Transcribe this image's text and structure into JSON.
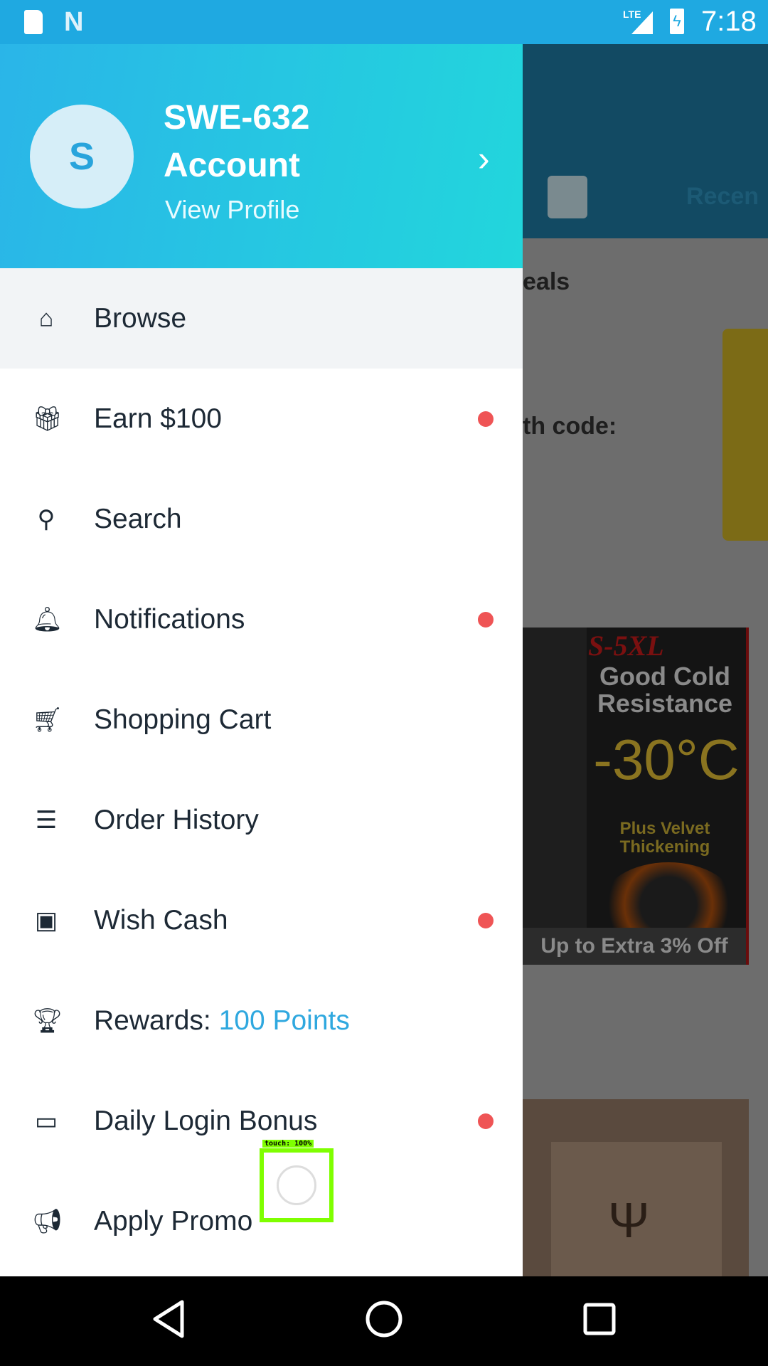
{
  "status_bar": {
    "network": "LTE",
    "time": "7:18",
    "n_icon": "N"
  },
  "drawer": {
    "avatar_initial": "S",
    "account_name_line1": "SWE-632",
    "account_name_line2": "Account",
    "view_profile": "View Profile",
    "items": [
      {
        "label": "Browse",
        "icon": "home-icon",
        "glyph": "⌂",
        "badge": false
      },
      {
        "label": "Earn $100",
        "icon": "gift-icon",
        "glyph": "🎁︎",
        "badge": true
      },
      {
        "label": "Search",
        "icon": "search-icon",
        "glyph": "⚲",
        "badge": false
      },
      {
        "label": "Notifications",
        "icon": "bell-icon",
        "glyph": "🔔︎",
        "badge": true
      },
      {
        "label": "Shopping Cart",
        "icon": "cart-icon",
        "glyph": "🛒︎",
        "badge": false
      },
      {
        "label": "Order History",
        "icon": "receipt-icon",
        "glyph": "☰",
        "badge": false
      },
      {
        "label": "Wish Cash",
        "icon": "wallet-icon",
        "glyph": "▣",
        "badge": true
      },
      {
        "label": "Rewards: ",
        "extra": "100 Points",
        "icon": "trophy-icon",
        "glyph": "🏆︎",
        "badge": false
      },
      {
        "label": "Daily Login Bonus",
        "icon": "calendar-icon",
        "glyph": "▭",
        "badge": true
      },
      {
        "label": "Apply Promo",
        "icon": "megaphone-icon",
        "glyph": "📢︎",
        "badge": false
      }
    ]
  },
  "background": {
    "tab_recent": "Recen",
    "section_deals": "eals",
    "code_text": "th code:",
    "ad": {
      "size": "S-5XL",
      "headline": "Good Cold Resistance",
      "temp": "-30°C",
      "sub": "Plus Velvet Thickening",
      "offer": "Up to Extra 3% Off"
    }
  },
  "touch_overlay": "touch: 100%",
  "colors": {
    "accent": "#2fa8df",
    "badge": "#ef5455",
    "status_bar": "#1fa9e1"
  }
}
